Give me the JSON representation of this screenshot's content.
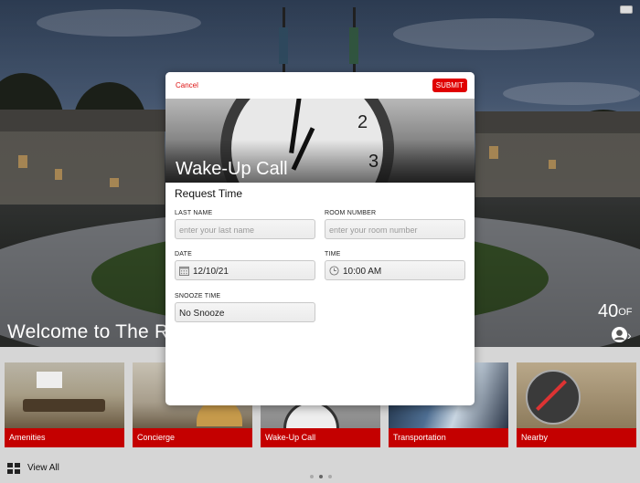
{
  "welcome_text": "Welcome to The R",
  "weather": {
    "temperature": "40",
    "unit": "OF"
  },
  "tiles": [
    {
      "label": "Amenities"
    },
    {
      "label": "Concierge"
    },
    {
      "label": "Wake-Up Call"
    },
    {
      "label": "Transportation"
    },
    {
      "label": "Nearby"
    }
  ],
  "bottom": {
    "view_all": "View All"
  },
  "modal": {
    "cancel": "Cancel",
    "submit": "SUBMIT",
    "title": "Wake-Up Call",
    "section": "Request Time",
    "last_name": {
      "label": "LAST NAME",
      "placeholder": "enter your last name"
    },
    "room_number": {
      "label": "ROOM NUMBER",
      "placeholder": "enter your room number"
    },
    "date": {
      "label": "DATE",
      "value": "12/10/21"
    },
    "time": {
      "label": "TIME",
      "value": "10:00 AM"
    },
    "snooze": {
      "label": "SNOOZE TIME",
      "value": "No Snooze"
    }
  },
  "colors": {
    "accent": "#e00000",
    "tile_label_bg": "#c40000"
  },
  "icons": [
    "user-icon",
    "chevron-right-icon",
    "grid-icon",
    "calendar-icon",
    "clock-icon"
  ]
}
